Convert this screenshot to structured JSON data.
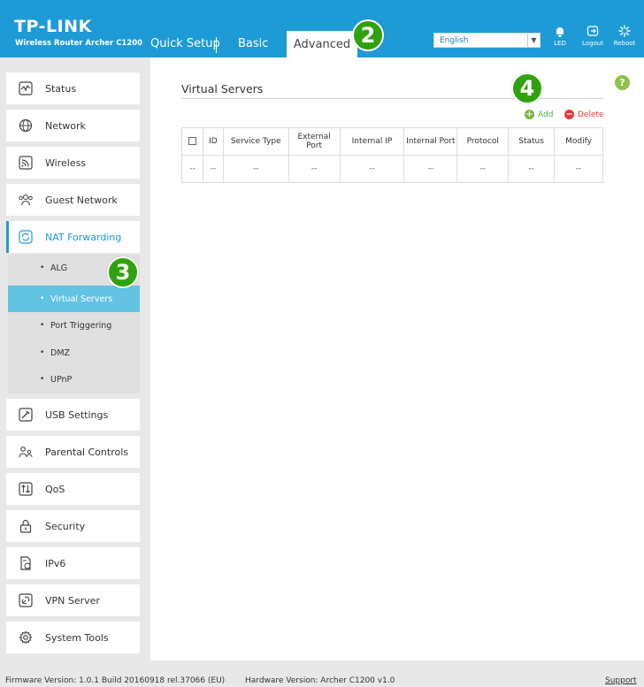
{
  "header": {
    "brand": "TP-LINK",
    "model": "Wireless Router Archer C1200",
    "tabs": [
      {
        "label": "Quick Setup"
      },
      {
        "label": "Basic"
      },
      {
        "label": "Advanced",
        "active": true
      }
    ],
    "language": {
      "selected": "English"
    },
    "buttons": {
      "led": "LED",
      "logout": "Logout",
      "reboot": "Reboot"
    },
    "accent_color": "#1e9bd6"
  },
  "callouts": {
    "tab": "2",
    "submenu": "3",
    "add": "4"
  },
  "sidebar": {
    "items": [
      {
        "label": "Status",
        "icon": "status-icon"
      },
      {
        "label": "Network",
        "icon": "globe-icon"
      },
      {
        "label": "Wireless",
        "icon": "wireless-icon"
      },
      {
        "label": "Guest Network",
        "icon": "guest-network-icon"
      },
      {
        "label": "NAT Forwarding",
        "icon": "nat-forwarding-icon",
        "active": true
      },
      {
        "label": "USB Settings",
        "icon": "usb-icon"
      },
      {
        "label": "Parental Controls",
        "icon": "parental-controls-icon"
      },
      {
        "label": "QoS",
        "icon": "qos-icon"
      },
      {
        "label": "Security",
        "icon": "lock-icon"
      },
      {
        "label": "IPv6",
        "icon": "ipv6-icon"
      },
      {
        "label": "VPN Server",
        "icon": "vpn-icon"
      },
      {
        "label": "System Tools",
        "icon": "gear-icon"
      }
    ],
    "submenu": [
      {
        "label": "ALG"
      },
      {
        "label": "Virtual Servers",
        "active": true
      },
      {
        "label": "Port Triggering"
      },
      {
        "label": "DMZ"
      },
      {
        "label": "UPnP"
      }
    ]
  },
  "main": {
    "title": "Virtual Servers",
    "help": "?",
    "actions": {
      "add": "Add",
      "delete": "Delete"
    },
    "table": {
      "headers": [
        "ID",
        "Service Type",
        "External Port",
        "Internal IP",
        "Internal Port",
        "Protocol",
        "Status",
        "Modify"
      ],
      "rows": [
        [
          "--",
          "--",
          "--",
          "--",
          "--",
          "--",
          "--",
          "--",
          "--"
        ]
      ]
    }
  },
  "footer": {
    "firmware": "Firmware Version: 1.0.1 Build 20160918 rel.37066 (EU)",
    "hardware": "Hardware Version: Archer C1200 v1.0",
    "support": "Support"
  }
}
